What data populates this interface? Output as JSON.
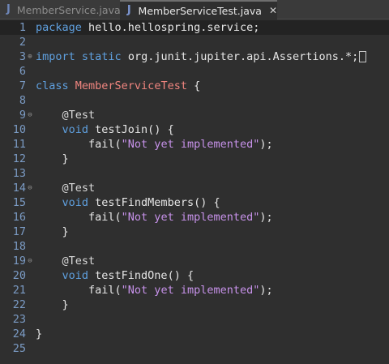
{
  "tabs": [
    {
      "label": "MemberService.java",
      "icon": "J",
      "active": false
    },
    {
      "label": "MemberServiceTest.java",
      "icon": "J",
      "active": true,
      "close": "✕"
    }
  ],
  "editor": {
    "lines": [
      {
        "n": "1",
        "fold": "",
        "tokens": [
          {
            "t": "package",
            "c": "kw"
          },
          {
            "t": " hello.hellospring.service;",
            "c": ""
          }
        ]
      },
      {
        "n": "2",
        "fold": "",
        "tokens": []
      },
      {
        "n": "3",
        "fold": "⊕",
        "tokens": [
          {
            "t": "import",
            "c": "kw"
          },
          {
            "t": " ",
            "c": ""
          },
          {
            "t": "static",
            "c": "kw"
          },
          {
            "t": " org.junit.jupiter.api.Assertions.*;",
            "c": ""
          },
          {
            "t": "",
            "c": "box"
          }
        ]
      },
      {
        "n": "6",
        "fold": "",
        "tokens": []
      },
      {
        "n": "7",
        "fold": "",
        "tokens": [
          {
            "t": "class",
            "c": "kw"
          },
          {
            "t": " ",
            "c": ""
          },
          {
            "t": "MemberServiceTest",
            "c": "cls"
          },
          {
            "t": " {",
            "c": ""
          }
        ]
      },
      {
        "n": "8",
        "fold": "",
        "tokens": []
      },
      {
        "n": "9",
        "fold": "⊖",
        "tokens": [
          {
            "t": "    ",
            "c": ""
          },
          {
            "t": "@Test",
            "c": "anno"
          }
        ]
      },
      {
        "n": "10",
        "fold": "",
        "tokens": [
          {
            "t": "    ",
            "c": ""
          },
          {
            "t": "void",
            "c": "kw"
          },
          {
            "t": " testJoin() {",
            "c": ""
          }
        ]
      },
      {
        "n": "11",
        "fold": "",
        "tokens": [
          {
            "t": "        fail(",
            "c": ""
          },
          {
            "t": "\"Not yet implemented\"",
            "c": "str"
          },
          {
            "t": ");",
            "c": ""
          }
        ]
      },
      {
        "n": "12",
        "fold": "",
        "tokens": [
          {
            "t": "    }",
            "c": ""
          }
        ]
      },
      {
        "n": "13",
        "fold": "",
        "tokens": []
      },
      {
        "n": "14",
        "fold": "⊖",
        "tokens": [
          {
            "t": "    ",
            "c": ""
          },
          {
            "t": "@Test",
            "c": "anno"
          }
        ]
      },
      {
        "n": "15",
        "fold": "",
        "tokens": [
          {
            "t": "    ",
            "c": ""
          },
          {
            "t": "void",
            "c": "kw"
          },
          {
            "t": " testFindMembers() {",
            "c": ""
          }
        ]
      },
      {
        "n": "16",
        "fold": "",
        "tokens": [
          {
            "t": "        fail(",
            "c": ""
          },
          {
            "t": "\"Not yet implemented\"",
            "c": "str"
          },
          {
            "t": ");",
            "c": ""
          }
        ]
      },
      {
        "n": "17",
        "fold": "",
        "tokens": [
          {
            "t": "    }",
            "c": ""
          }
        ]
      },
      {
        "n": "18",
        "fold": "",
        "tokens": []
      },
      {
        "n": "19",
        "fold": "⊖",
        "tokens": [
          {
            "t": "    ",
            "c": ""
          },
          {
            "t": "@Test",
            "c": "anno"
          }
        ]
      },
      {
        "n": "20",
        "fold": "",
        "tokens": [
          {
            "t": "    ",
            "c": ""
          },
          {
            "t": "void",
            "c": "kw"
          },
          {
            "t": " testFindOne() {",
            "c": ""
          }
        ]
      },
      {
        "n": "21",
        "fold": "",
        "tokens": [
          {
            "t": "        fail(",
            "c": ""
          },
          {
            "t": "\"Not yet implemented\"",
            "c": "str"
          },
          {
            "t": ");",
            "c": ""
          }
        ]
      },
      {
        "n": "22",
        "fold": "",
        "tokens": [
          {
            "t": "    }",
            "c": ""
          }
        ]
      },
      {
        "n": "23",
        "fold": "",
        "tokens": []
      },
      {
        "n": "24",
        "fold": "",
        "tokens": [
          {
            "t": "}",
            "c": ""
          }
        ]
      },
      {
        "n": "25",
        "fold": "",
        "tokens": []
      }
    ]
  },
  "colors": {
    "background": "#2f2f2f",
    "keyword": "#5fa0df",
    "class_name": "#f0857f",
    "string": "#c792ea",
    "line_number": "#7b9bc4",
    "current_line": "#232323"
  }
}
